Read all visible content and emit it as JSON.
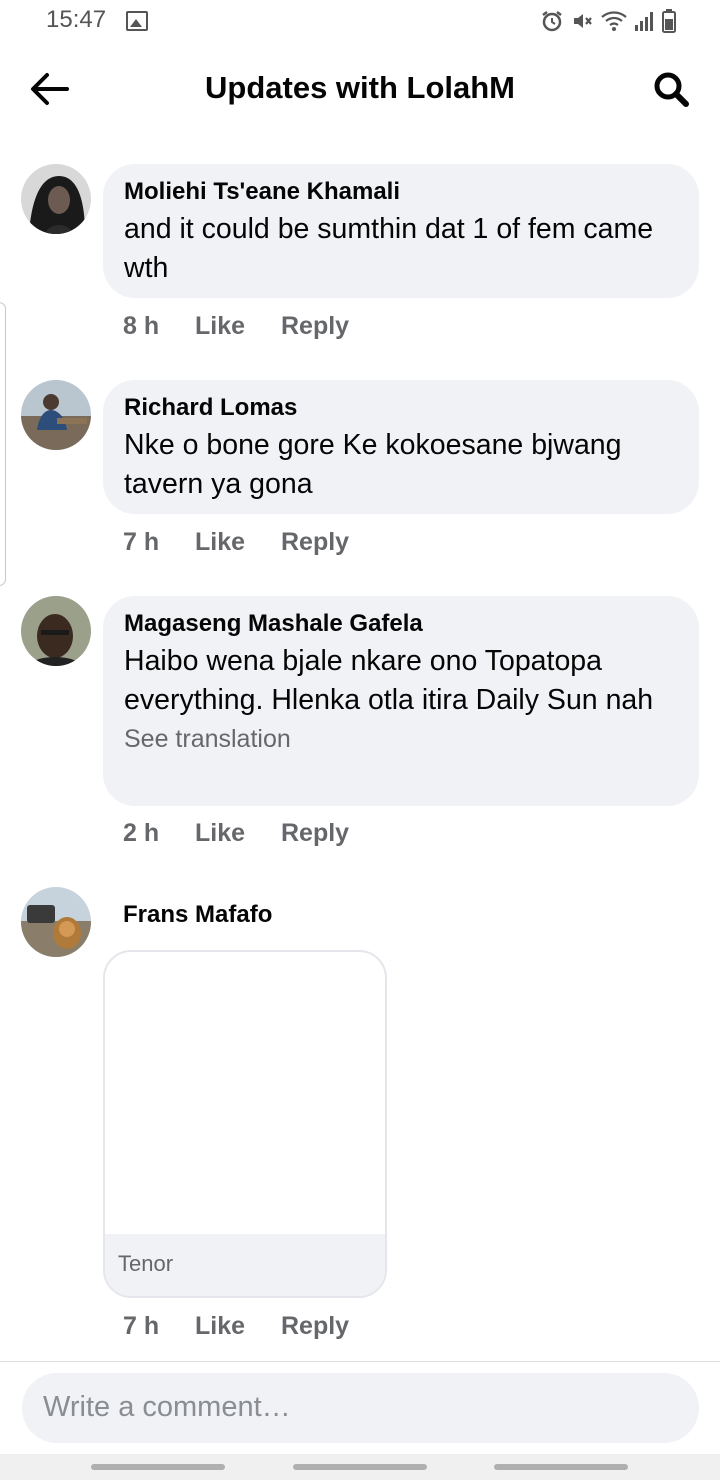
{
  "status_bar": {
    "time": "15:47",
    "icons": [
      "image-icon",
      "alarm-icon",
      "mute-icon",
      "wifi-icon",
      "signal-icon",
      "battery-icon"
    ]
  },
  "header": {
    "title": "Updates with LolahM",
    "back_icon": "arrow-left-icon",
    "search_icon": "search-icon"
  },
  "comments": [
    {
      "author": "Moliehi Ts'eane Khamali",
      "text": "and it could be sumthin dat 1 of fem came wth",
      "time": "8 h",
      "like_label": "Like",
      "reply_label": "Reply"
    },
    {
      "author": "Richard Lomas",
      "text": "Nke o bone gore Ke kokoesane bjwang tavern ya gona",
      "time": "7 h",
      "like_label": "Like",
      "reply_label": "Reply"
    },
    {
      "author": "Magaseng Mashale Gafela",
      "text": "Haibo wena bjale nkare ono Topatopa everything. Hlenka otla itira Daily Sun nah",
      "see_translation": "See translation",
      "time": "2 h",
      "like_label": "Like",
      "reply_label": "Reply"
    },
    {
      "author": "Frans Mafafo",
      "gif_source": "Tenor",
      "time": "7 h",
      "like_label": "Like",
      "reply_label": "Reply"
    }
  ],
  "composer": {
    "placeholder": "Write a comment…"
  },
  "colors": {
    "bubble": "#f0f2f5",
    "secondary_text": "#65676b",
    "primary_text": "#050505"
  }
}
